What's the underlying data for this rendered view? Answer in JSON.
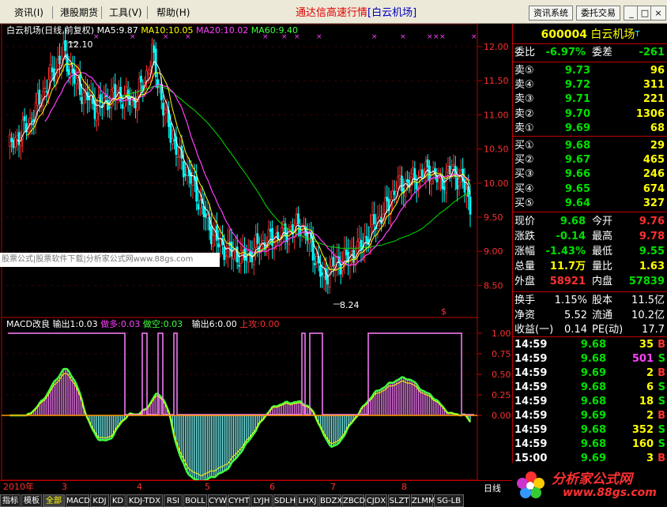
{
  "menubar": {
    "items": [
      "资讯",
      "港股期货",
      "工具",
      "帮助"
    ],
    "hotkeys": [
      "(I)",
      "",
      "(V)",
      "(H)"
    ],
    "title_main": "通达信高速行情",
    "title_sub": "[白云机场]",
    "sys_buttons": [
      "资讯系统",
      "委托交易"
    ],
    "window_buttons": [
      "_",
      "□",
      "×"
    ]
  },
  "kline": {
    "title": "白云机场(日线,前复权)",
    "ma5": "MA5:9.87",
    "ma10": "MA10:10.05",
    "ma20": "MA20:10.02",
    "ma60": "MA60:9.40",
    "high_label": "12.10",
    "low_label": "8.24",
    "y_ticks": [
      "12.00",
      "11.50",
      "11.00",
      "10.50",
      "10.00",
      "9.50",
      "9.00",
      "8.50"
    ],
    "s_marker": "$"
  },
  "macd": {
    "title": "MACD改良",
    "out1": "输出1:0.03",
    "zuoduo": "做多:0.03",
    "zuokong": "做空:0.03",
    "out6": "输出6:0.00",
    "shanggong": "上攻:0.00",
    "y_ticks": [
      "1.00",
      "0.75",
      "0.50",
      "0.25",
      "0.00"
    ]
  },
  "watermark": "股票公式|股票软件下载|分析家公式网www.88gs.com",
  "time_axis": {
    "labels": [
      "2010年",
      "3",
      "4",
      "5",
      "6",
      "7",
      "8"
    ],
    "period": "日线"
  },
  "tabs": [
    "指标",
    "模板",
    "全部",
    "MACD",
    "KDJ",
    "KD",
    "KDJ-TDX",
    "RSI",
    "BOLL",
    "CYW",
    "CYHT",
    "LYJH",
    "SDLH",
    "LHXJ",
    "BDZX",
    "ZBCD",
    "CJDX",
    "SLZT",
    "ZLMM",
    "SG-LB"
  ],
  "quote": {
    "code": "600004",
    "name": "白云机场",
    "mark": "T",
    "weibi_label": "委比",
    "weibi_value": "-6.97%",
    "weicha_label": "委差",
    "weicha_value": "-261",
    "sells": [
      {
        "label": "卖⑤",
        "price": "9.73",
        "vol": "96"
      },
      {
        "label": "卖④",
        "price": "9.72",
        "vol": "311"
      },
      {
        "label": "卖③",
        "price": "9.71",
        "vol": "221"
      },
      {
        "label": "卖②",
        "price": "9.70",
        "vol": "1306"
      },
      {
        "label": "卖①",
        "price": "9.69",
        "vol": "68"
      }
    ],
    "buys": [
      {
        "label": "买①",
        "price": "9.68",
        "vol": "29"
      },
      {
        "label": "买②",
        "price": "9.67",
        "vol": "465"
      },
      {
        "label": "买③",
        "price": "9.66",
        "vol": "246"
      },
      {
        "label": "买④",
        "price": "9.65",
        "vol": "674"
      },
      {
        "label": "买⑤",
        "price": "9.64",
        "vol": "327"
      }
    ],
    "stats": [
      {
        "l1": "现价",
        "v1": "9.68",
        "c1": "#00e000",
        "l2": "今开",
        "v2": "9.76",
        "c2": "#ff3030"
      },
      {
        "l1": "涨跌",
        "v1": "-0.14",
        "c1": "#00e000",
        "l2": "最高",
        "v2": "9.78",
        "c2": "#ff3030"
      },
      {
        "l1": "涨幅",
        "v1": "-1.43%",
        "c1": "#00e000",
        "l2": "最低",
        "v2": "9.55",
        "c2": "#00e000"
      },
      {
        "l1": "总量",
        "v1": "11.7万",
        "c1": "#ffff00",
        "l2": "量比",
        "v2": "1.63",
        "c2": "#ffff00"
      },
      {
        "l1": "外盘",
        "v1": "58921",
        "c1": "#ff3030",
        "l2": "内盘",
        "v2": "57839",
        "c2": "#00e000"
      }
    ],
    "fund": [
      {
        "l1": "换手",
        "v1": "1.15%",
        "l2": "股本",
        "v2": "11.5亿"
      },
      {
        "l1": "净资",
        "v1": "5.52",
        "l2": "流通",
        "v2": "10.2亿"
      },
      {
        "l1": "收益(一)",
        "v1": "0.14",
        "l2": "PE(动)",
        "v2": "17.7"
      }
    ],
    "trades": [
      {
        "time": "14:59",
        "price": "9.68",
        "vol": "35",
        "bs": "B",
        "vc": "#ffff00",
        "bc": "#ff3030"
      },
      {
        "time": "14:59",
        "price": "9.68",
        "vol": "501",
        "bs": "S",
        "vc": "#ff40ff",
        "bc": "#00e000"
      },
      {
        "time": "14:59",
        "price": "9.69",
        "vol": "2",
        "bs": "B",
        "vc": "#ffff00",
        "bc": "#ff3030"
      },
      {
        "time": "14:59",
        "price": "9.68",
        "vol": "6",
        "bs": "S",
        "vc": "#ffff00",
        "bc": "#00e000"
      },
      {
        "time": "14:59",
        "price": "9.68",
        "vol": "18",
        "bs": "S",
        "vc": "#ffff00",
        "bc": "#00e000"
      },
      {
        "time": "14:59",
        "price": "9.69",
        "vol": "2",
        "bs": "B",
        "vc": "#ffff00",
        "bc": "#ff3030"
      },
      {
        "time": "14:59",
        "price": "9.68",
        "vol": "352",
        "bs": "S",
        "vc": "#ffff00",
        "bc": "#00e000"
      },
      {
        "time": "14:59",
        "price": "9.68",
        "vol": "160",
        "bs": "S",
        "vc": "#ffff00",
        "bc": "#00e000"
      },
      {
        "time": "15:00",
        "price": "9.69",
        "vol": "3",
        "bs": "B",
        "vc": "#ffff00",
        "bc": "#ff3030"
      }
    ]
  },
  "logo": {
    "text": "分析家公式网",
    "url": "www.88gs.com"
  },
  "colors": {
    "up": "#ff3030",
    "down": "#00e000",
    "ma5": "#ffffff",
    "ma10": "#ffff00",
    "ma20": "#ff40ff",
    "ma60": "#00e000",
    "grid": "#c00000"
  }
}
